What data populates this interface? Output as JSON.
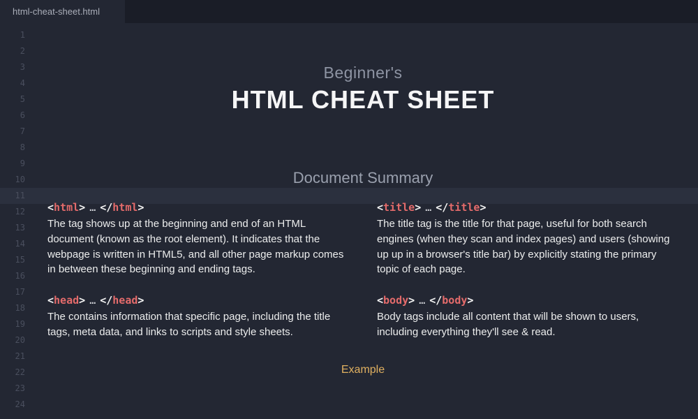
{
  "tab": {
    "filename": "html-cheat-sheet.html"
  },
  "gutter": {
    "start": 1,
    "end": 24
  },
  "header": {
    "supertitle": "Beginner's",
    "title": "HTML CHEAT SHEET"
  },
  "section": {
    "heading": "Document Summary",
    "example_label": "Example",
    "entries": [
      {
        "tag": "html",
        "desc": "The tag shows up at the beginning and end of an HTML document (known as the root element). It indicates that the webpage is written in HTML5, and all other page markup comes in between these beginning and ending tags."
      },
      {
        "tag": "title",
        "desc": "The title tag is the title for that page, useful for both search engines (when they scan and index pages) and users (showing up up in a browser's title bar) by explicitly stating the primary topic of each page."
      },
      {
        "tag": "head",
        "desc": "The contains information that specific page, including the title tags, meta data, and links to scripts and style sheets."
      },
      {
        "tag": "body",
        "desc": "Body tags include all content that will be shown to users, including everything they'll see & read."
      }
    ]
  }
}
